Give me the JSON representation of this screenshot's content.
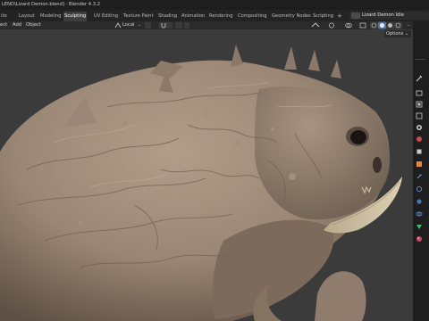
{
  "window": {
    "title": "LEND\\Lizard Demon.blend] - Blender 4.3.2"
  },
  "tabs": [
    {
      "label": "ito"
    },
    {
      "label": "Layout"
    },
    {
      "label": "Modeling"
    },
    {
      "label": "Sculpting"
    },
    {
      "label": "UV Editing"
    },
    {
      "label": "Texture Paint"
    },
    {
      "label": "Shading"
    },
    {
      "label": "Animation"
    },
    {
      "label": "Rendering"
    },
    {
      "label": "Compositing"
    },
    {
      "label": "Geometry Nodes"
    },
    {
      "label": "Scripting"
    }
  ],
  "active_tab": "Sculpting",
  "tabs_plus": "+",
  "scene": {
    "name": "Lizard Demon Idle"
  },
  "toolbar": {
    "menus": [
      "ect",
      "Add",
      "Object"
    ],
    "orientation": "Local",
    "options_label": "Options"
  },
  "colors": {
    "accent_blue": "#4772b3",
    "sculpt_clay": "#9a8674",
    "horn": "#c8b99a"
  },
  "icons": {
    "properties": [
      "tool-icon",
      "render-icon",
      "output-icon",
      "view-layer-icon",
      "scene-icon",
      "world-icon",
      "object-icon",
      "modifier-icon",
      "particles-icon",
      "physics-icon",
      "constraints-icon",
      "data-icon",
      "material-icon"
    ]
  }
}
